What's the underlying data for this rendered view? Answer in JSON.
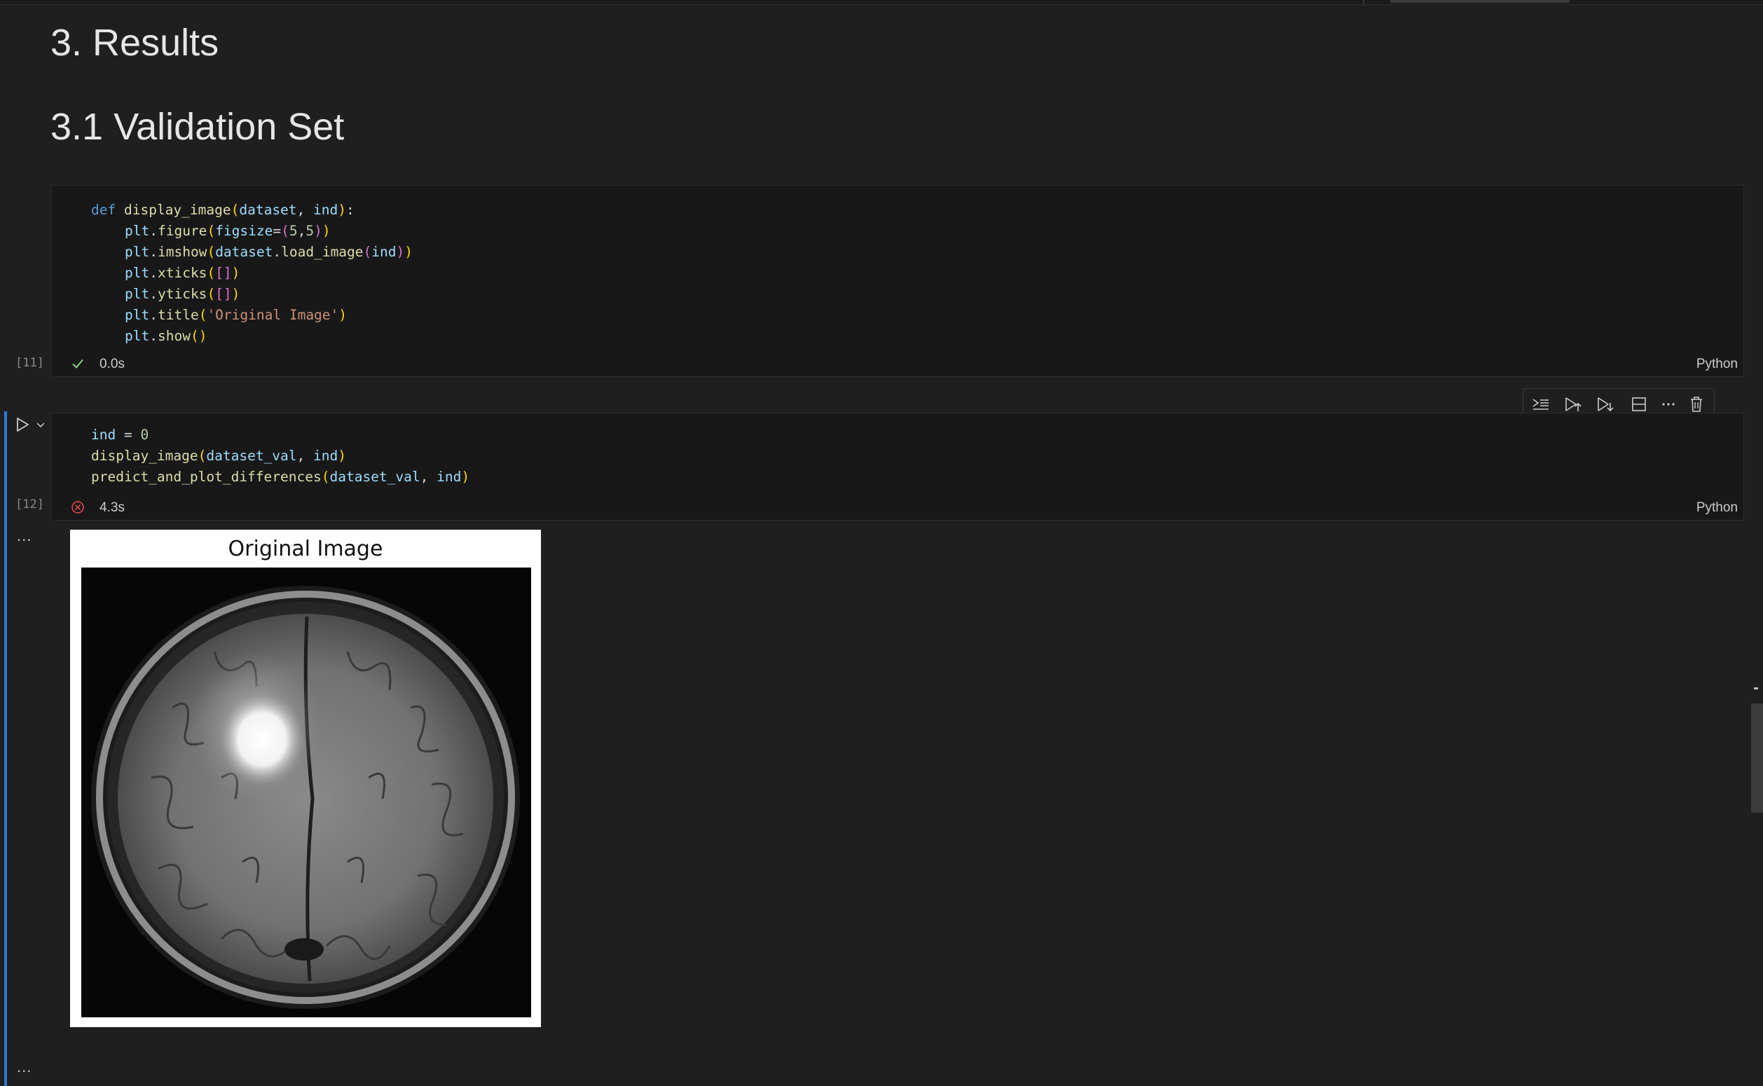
{
  "headings": {
    "results": "3. Results",
    "validation": "3.1 Validation Set"
  },
  "cell1": {
    "exec_count": "[11]",
    "status": "success",
    "exec_time": "0.0s",
    "language": "Python",
    "code": {
      "l1_def": "def",
      "l1_fn": "display_image",
      "l1_p1": "dataset",
      "l1_p2": "ind",
      "l2_obj": "plt",
      "l2_fn": "figure",
      "l2_arg": "figsize",
      "l2_v1": "5",
      "l2_v2": "5",
      "l3_obj": "plt",
      "l3_fn": "imshow",
      "l3_obj2": "dataset",
      "l3_fn2": "load_image",
      "l3_arg": "ind",
      "l4_obj": "plt",
      "l4_fn": "xticks",
      "l5_obj": "plt",
      "l5_fn": "yticks",
      "l6_obj": "plt",
      "l6_fn": "title",
      "l6_str": "'Original Image'",
      "l7_obj": "plt",
      "l7_fn": "show"
    }
  },
  "cell2": {
    "exec_count": "[12]",
    "status": "error",
    "exec_time": "4.3s",
    "language": "Python",
    "code": {
      "l1_var": "ind",
      "l1_val": "0",
      "l2_fn": "display_image",
      "l2_a1": "dataset_val",
      "l2_a2": "ind",
      "l3_fn": "predict_and_plot_differences",
      "l3_a1": "dataset_val",
      "l3_a2": "ind"
    }
  },
  "toolbar": {
    "icons": [
      "execute-above-icon",
      "execute-cell-and-above-icon",
      "execute-cell-and-below-icon",
      "split-cell-icon",
      "more-actions-icon",
      "delete-cell-icon"
    ]
  },
  "output": {
    "ellipsis": "...",
    "figure_title": "Original Image"
  },
  "colors": {
    "background": "#1f1f1f",
    "cell_background": "#181818",
    "active_bar": "#2b79d6",
    "success": "#89d185",
    "error": "#f14c4c"
  }
}
